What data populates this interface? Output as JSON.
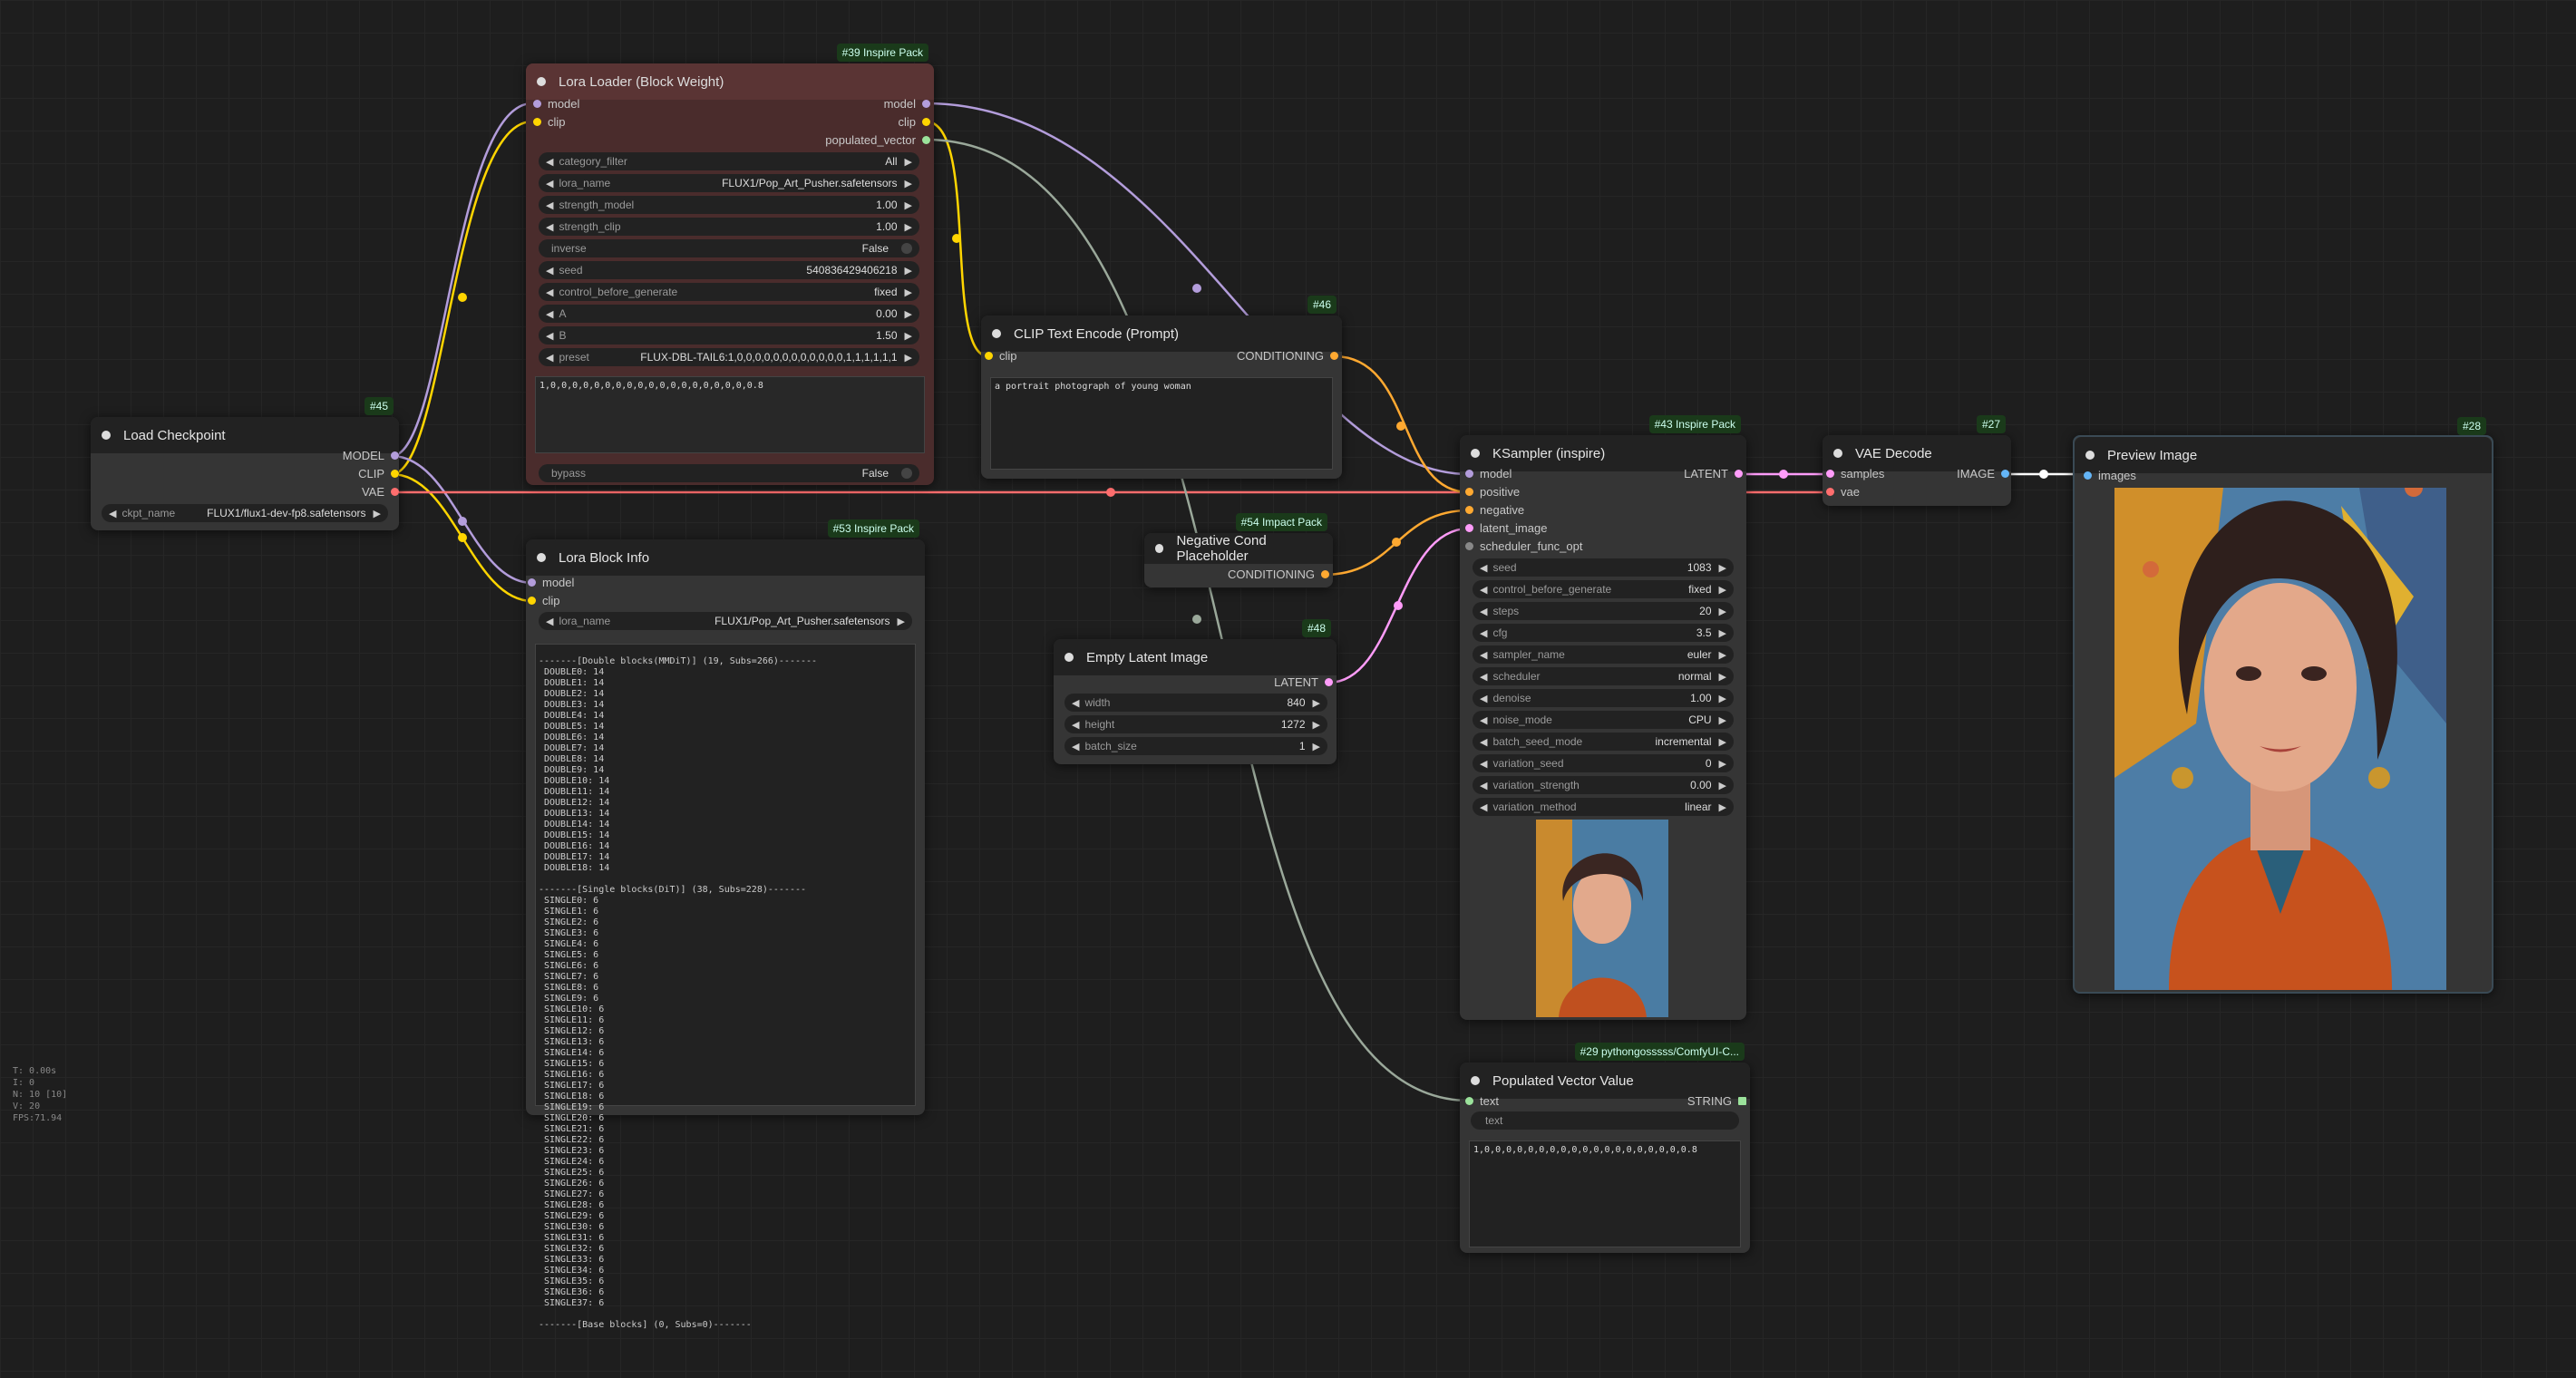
{
  "overlay": {
    "t": "T: 0.00s",
    "i": "I: 0",
    "n": "N: 10 [10]",
    "v": "V: 20",
    "fps": "FPS:71.94"
  },
  "colors": {
    "model": "#b39ddb",
    "clip": "#ffd500",
    "vae": "#ff6e6e",
    "conditioning": "#ffa931",
    "latent": "#ff9cf9",
    "image": "#64b5f6",
    "string": "#9be29b"
  },
  "nodes": {
    "load_checkpoint": {
      "badge": "#45",
      "title": "Load Checkpoint",
      "outputs": [
        "MODEL",
        "CLIP",
        "VAE"
      ],
      "widgets": [
        {
          "name": "ckpt_name",
          "value": "FLUX1/flux1-dev-fp8.safetensors"
        }
      ]
    },
    "lora_loader": {
      "badge": "#39 Inspire Pack",
      "title": "Lora Loader (Block Weight)",
      "inputs": [
        "model",
        "clip"
      ],
      "outputs": [
        "model",
        "clip",
        "populated_vector"
      ],
      "widgets": [
        {
          "name": "category_filter",
          "value": "All"
        },
        {
          "name": "lora_name",
          "value": "FLUX1/Pop_Art_Pusher.safetensors"
        },
        {
          "name": "strength_model",
          "value": "1.00"
        },
        {
          "name": "strength_clip",
          "value": "1.00"
        },
        {
          "name": "inverse",
          "value": "False"
        },
        {
          "name": "seed",
          "value": "540836429406218"
        },
        {
          "name": "control_before_generate",
          "value": "fixed"
        },
        {
          "name": "A",
          "value": "0.00"
        },
        {
          "name": "B",
          "value": "1.50"
        },
        {
          "name": "preset",
          "value": "FLUX-DBL-TAIL6:1,0,0,0,0,0,0,0,0,0,0,0,0,1,1,1,1,1,1"
        }
      ],
      "text": "1,0,0,0,0,0,0,0,0,0,0,0,0,0,0,0,0,0,0,0.8",
      "bypass": {
        "name": "bypass",
        "value": "False"
      }
    },
    "lora_block_info": {
      "badge": "#53 Inspire Pack",
      "title": "Lora Block Info",
      "inputs": [
        "model",
        "clip"
      ],
      "widgets": [
        {
          "name": "lora_name",
          "value": "FLUX1/Pop_Art_Pusher.safetensors"
        }
      ],
      "double_header": "-------[Double blocks(MMDiT)] (19, Subs=266)-------",
      "double_lines": [
        "DOUBLE0: 14",
        "DOUBLE1: 14",
        "DOUBLE2: 14",
        "DOUBLE3: 14",
        "DOUBLE4: 14",
        "DOUBLE5: 14",
        "DOUBLE6: 14",
        "DOUBLE7: 14",
        "DOUBLE8: 14",
        "DOUBLE9: 14",
        "DOUBLE10: 14",
        "DOUBLE11: 14",
        "DOUBLE12: 14",
        "DOUBLE13: 14",
        "DOUBLE14: 14",
        "DOUBLE15: 14",
        "DOUBLE16: 14",
        "DOUBLE17: 14",
        "DOUBLE18: 14"
      ],
      "single_header": "-------[Single blocks(DiT)] (38, Subs=228)-------",
      "single_lines": [
        "SINGLE0: 6",
        "SINGLE1: 6",
        "SINGLE2: 6",
        "SINGLE3: 6",
        "SINGLE4: 6",
        "SINGLE5: 6",
        "SINGLE6: 6",
        "SINGLE7: 6",
        "SINGLE8: 6",
        "SINGLE9: 6",
        "SINGLE10: 6",
        "SINGLE11: 6",
        "SINGLE12: 6",
        "SINGLE13: 6",
        "SINGLE14: 6",
        "SINGLE15: 6",
        "SINGLE16: 6",
        "SINGLE17: 6",
        "SINGLE18: 6",
        "SINGLE19: 6",
        "SINGLE20: 6",
        "SINGLE21: 6",
        "SINGLE22: 6",
        "SINGLE23: 6",
        "SINGLE24: 6",
        "SINGLE25: 6",
        "SINGLE26: 6",
        "SINGLE27: 6",
        "SINGLE28: 6",
        "SINGLE29: 6",
        "SINGLE30: 6",
        "SINGLE31: 6",
        "SINGLE32: 6",
        "SINGLE33: 6",
        "SINGLE34: 6",
        "SINGLE35: 6",
        "SINGLE36: 6",
        "SINGLE37: 6"
      ],
      "base_header": "-------[Base blocks] (0, Subs=0)-------"
    },
    "clip_text_encode": {
      "badge": "#46",
      "title": "CLIP Text Encode (Prompt)",
      "inputs": [
        "clip"
      ],
      "outputs": [
        "CONDITIONING"
      ],
      "text": "a portrait photograph of young woman"
    },
    "negative_cond": {
      "badge": "#54 Impact Pack",
      "title": "Negative Cond Placeholder",
      "outputs": [
        "CONDITIONING"
      ]
    },
    "empty_latent": {
      "badge": "#48",
      "title": "Empty Latent Image",
      "outputs": [
        "LATENT"
      ],
      "widgets": [
        {
          "name": "width",
          "value": "840"
        },
        {
          "name": "height",
          "value": "1272"
        },
        {
          "name": "batch_size",
          "value": "1"
        }
      ]
    },
    "ksampler": {
      "badge": "#43 Inspire Pack",
      "title": "KSampler (inspire)",
      "inputs": [
        "model",
        "positive",
        "negative",
        "latent_image",
        "scheduler_func_opt"
      ],
      "outputs": [
        "LATENT"
      ],
      "widgets": [
        {
          "name": "seed",
          "value": "1083"
        },
        {
          "name": "control_before_generate",
          "value": "fixed"
        },
        {
          "name": "steps",
          "value": "20"
        },
        {
          "name": "cfg",
          "value": "3.5"
        },
        {
          "name": "sampler_name",
          "value": "euler"
        },
        {
          "name": "scheduler",
          "value": "normal"
        },
        {
          "name": "denoise",
          "value": "1.00"
        },
        {
          "name": "noise_mode",
          "value": "CPU"
        },
        {
          "name": "batch_seed_mode",
          "value": "incremental"
        },
        {
          "name": "variation_seed",
          "value": "0"
        },
        {
          "name": "variation_strength",
          "value": "0.00"
        },
        {
          "name": "variation_method",
          "value": "linear"
        }
      ]
    },
    "vae_decode": {
      "badge": "#27",
      "title": "VAE Decode",
      "inputs": [
        "samples",
        "vae"
      ],
      "outputs": [
        "IMAGE"
      ]
    },
    "preview_image": {
      "badge": "#28",
      "title": "Preview Image",
      "inputs": [
        "images"
      ]
    },
    "populated_vector": {
      "badge": "#29 pythongosssss/ComfyUI-C...",
      "title": "Populated Vector Value",
      "inputs": [
        "text"
      ],
      "outputs": [
        "STRING"
      ],
      "widget_text": "text",
      "text": "1,0,0,0,0,0,0,0,0,0,0,0,0,0,0,0,0,0,0,0.8"
    }
  }
}
